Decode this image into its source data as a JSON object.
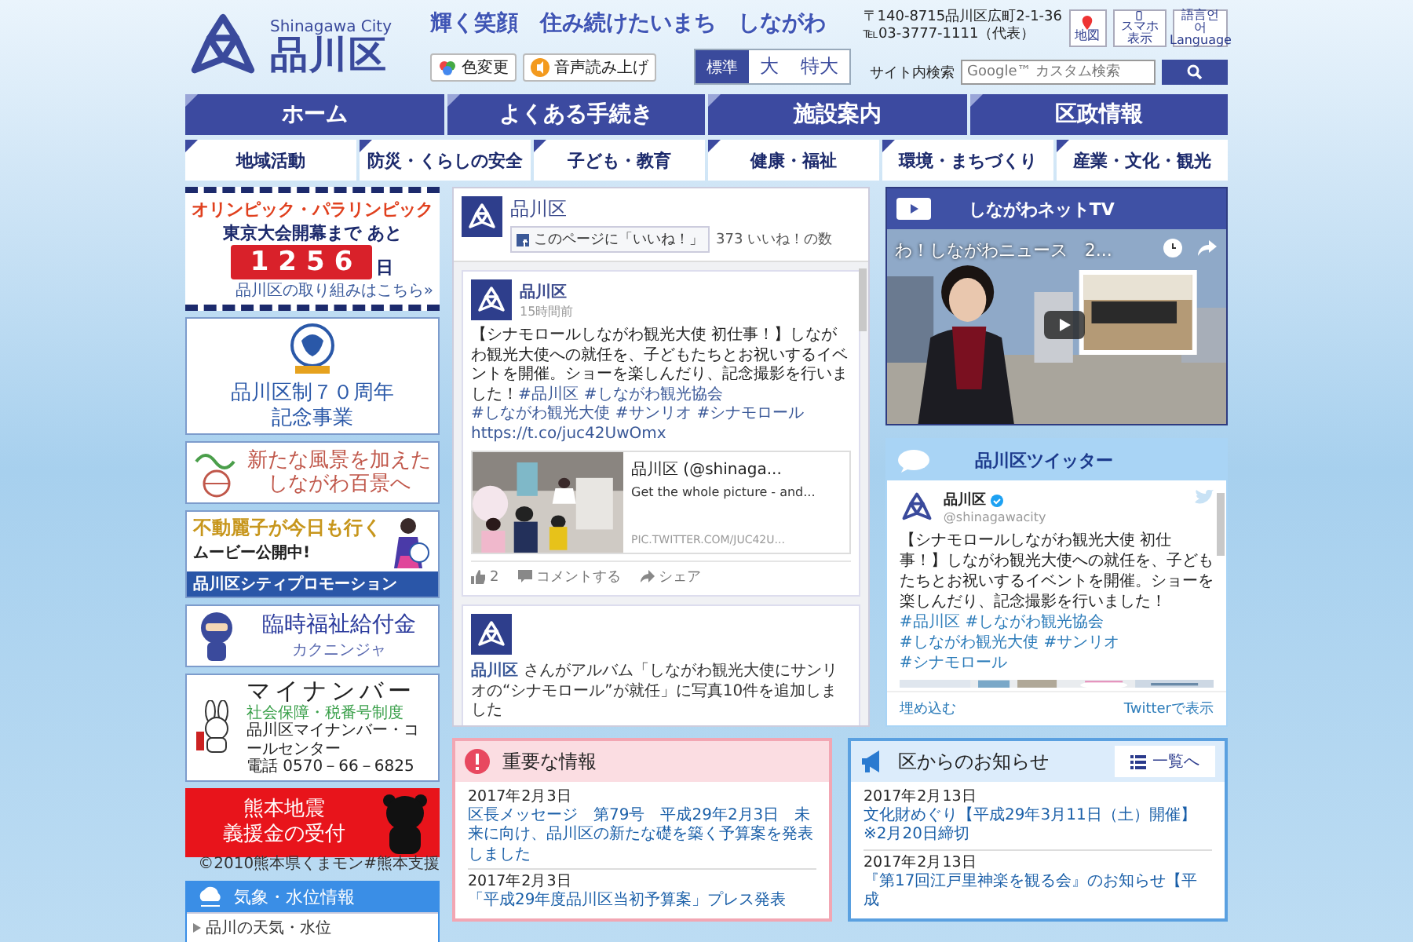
{
  "header": {
    "city_en": "Shinagawa City",
    "city_ja": "品川区",
    "slogan": "輝く笑顔　住み続けたいまち　しながわ",
    "address": "〒140-8715品川区広町2-1-36",
    "tel": "℡03-3777-1111（代表）",
    "icon_links": [
      {
        "kind": "map",
        "label": "地図"
      },
      {
        "kind": "phone",
        "label": "スマホ表示"
      },
      {
        "kind": "language",
        "label": "語言언어",
        "sub": "Language"
      }
    ],
    "tools": [
      {
        "kind": "color",
        "label": "色変更"
      },
      {
        "kind": "voice",
        "label": "音声読み上げ"
      }
    ],
    "font_sizes": [
      {
        "label": "標準",
        "selected": true
      },
      {
        "label": "大",
        "selected": false
      },
      {
        "label": "特大",
        "selected": false
      }
    ],
    "search_label": "サイト内検索",
    "search_placeholder": "Google™ カスタム検索"
  },
  "main_nav": [
    "ホーム",
    "よくある手続き",
    "施設案内",
    "区政情報"
  ],
  "sub_nav": [
    "地域活動",
    "防災・くらしの安全",
    "子ども・教育",
    "健康・福祉",
    "環境・まちづくり",
    "産業・文化・観光"
  ],
  "banners": [
    {
      "kind": "olympic",
      "title": "オリンピック・パラリンピック",
      "lead": "東京大会開幕まで あと",
      "count": "1256",
      "unit": "日",
      "link": "品川区の取り組みはこちら»"
    },
    {
      "kind": "anniversary",
      "lines": [
        "品川区制７０周年",
        "記念事業"
      ]
    },
    {
      "kind": "scenery",
      "lines": [
        "新たな風景を加えた",
        "しながわ百景へ"
      ]
    },
    {
      "kind": "promotion",
      "lines": [
        "不動麗子が今日も行く",
        "ムービー公開中!"
      ],
      "footer": "品川区シティプロモーション"
    },
    {
      "kind": "welfare",
      "lines": [
        "臨時福祉給付金"
      ],
      "mascot": "カクニンジャ"
    },
    {
      "kind": "mynumber",
      "lines": [
        "マイナンバー",
        "社会保障・税番号制度",
        "品川区マイナンバー・コールセンター",
        "電話 0570－66－6825"
      ]
    },
    {
      "kind": "earthquake",
      "lines": [
        "熊本地震",
        "義援金の受付"
      ],
      "caption": "©2010熊本県くまモン#熊本支援"
    },
    {
      "kind": "weather",
      "title": "気象・水位情報",
      "item": "品川の天気・水位"
    }
  ],
  "facebook": {
    "page_name": "品川区",
    "like_button": "このページに「いいね！」",
    "like_count": "373 いいね！の数",
    "post": {
      "author": "品川区",
      "time": "15時間前",
      "segments": [
        {
          "kind": "text",
          "text": "【シナモロールしながわ観光大使 初仕事！】しながわ観光大使への就任を、子どもたちとお祝いするイベントを開催。ショーを楽しんだり、記念撮影を行いました！"
        },
        {
          "kind": "link",
          "text": "#品川区"
        },
        {
          "kind": "link",
          "text": "#しながわ観光協会"
        },
        {
          "kind": "link",
          "text": "#しながわ観光大使"
        },
        {
          "kind": "link",
          "text": "#サンリオ"
        },
        {
          "kind": "link",
          "text": "#シナモロール"
        },
        {
          "kind": "link",
          "text": "https://t.co/juc42UwOmx"
        }
      ],
      "card": {
        "title": "品川区 (@shinaga...",
        "description": "Get the whole picture - and...",
        "domain": "PIC.TWITTER.COM/JUC42U..."
      },
      "likes": "2",
      "comment": "コメントする",
      "share": "シェア"
    },
    "post2": {
      "author": "品川区",
      "text": "さんがアルバム「しながわ観光大使にサンリオの“シナモロール”が就任」に写真10件を追加しました"
    }
  },
  "net_tv": {
    "title": "しながわネットTV",
    "video_title": "わ！しながわニュース　2..."
  },
  "twitter": {
    "title": "品川区ツイッター",
    "name": "品川区",
    "handle": "@shinagawacity",
    "segments": [
      {
        "kind": "text",
        "text": "【シナモロールしながわ観光大使 初仕事！】しながわ観光大使への就任を、子どもたちとお祝いするイベントを開催。ショーを楽しんだり、記念撮影を行いました！"
      },
      {
        "kind": "link",
        "text": "#品川区"
      },
      {
        "kind": "link",
        "text": "#しながわ観光協会"
      },
      {
        "kind": "link",
        "text": "#しながわ観光大使"
      },
      {
        "kind": "link",
        "text": "#サンリオ"
      },
      {
        "kind": "link",
        "text": "#シナモロール"
      }
    ],
    "embed": "埋め込む",
    "view": "Twitterで表示"
  },
  "important": {
    "title": "重要な情報",
    "items": [
      {
        "date": "2017年2月3日",
        "text": "区長メッセージ　第79号　平成29年2月3日　未来に向け、品川区の新たな礎を築く予算案を発表しました"
      },
      {
        "date": "2017年2月3日",
        "text": "「平成29年度品川区当初予算案」プレス発表"
      }
    ]
  },
  "notices": {
    "title": "区からのお知らせ",
    "list_button": "一覧へ",
    "items": [
      {
        "date": "2017年2月13日",
        "text": "文化財めぐり【平成29年3月11日（土）開催】※2月20日締切"
      },
      {
        "date": "2017年2月13日",
        "text": "『第17回江戸里神楽を観る会』のお知らせ【平成"
      }
    ]
  }
}
